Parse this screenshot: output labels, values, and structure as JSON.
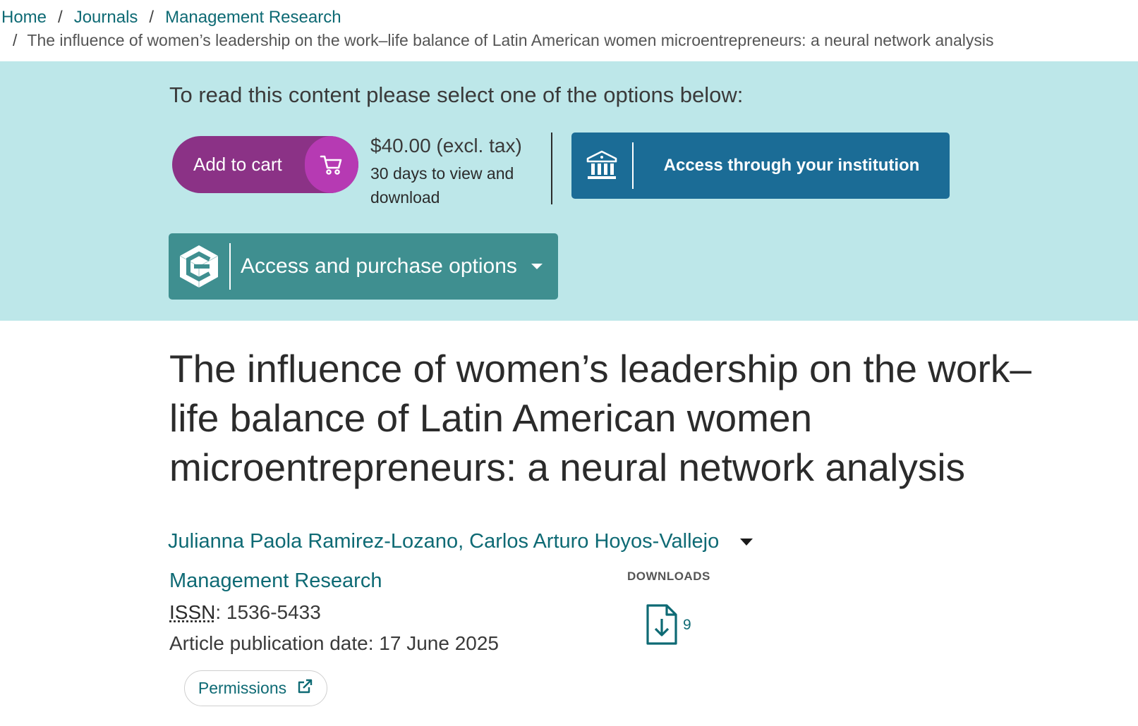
{
  "breadcrumb": {
    "home": "Home",
    "journals": "Journals",
    "journal": "Management Research",
    "current": "The influence of women’s leadership on the work–life balance of Latin American women microentrepreneurs: a neural network analysis",
    "separator": "/"
  },
  "access": {
    "prompt": "To read this content please select one of the options below:",
    "cart_label": "Add to cart",
    "price": "$40.00 (excl. tax)",
    "price_note": "30 days to view and download",
    "institution_label": "Access through your institution",
    "purchase_label": "Access and purchase options",
    "band_color": "#bde7e9",
    "cart_color": "#8b3286",
    "institution_color": "#1b6c96",
    "purchase_color": "#3f8f90"
  },
  "article": {
    "title": "The influence of women’s leadership on the work–life balance of Latin American women microentrepreneurs: a neural network analysis",
    "authors": "Julianna Paola Ramirez-Lozano, Carlos Arturo Hoyos-Vallejo",
    "journal": "Management Research",
    "issn_label": "ISSN",
    "issn_value": ": 1536-5433",
    "publication_date": "Article publication date: 17 June 2025",
    "permissions_label": "Permissions"
  },
  "metrics": {
    "downloads_label": "DOWNLOADS",
    "downloads_count": "9"
  },
  "icons": {
    "cart": "shopping-cart-icon",
    "institution": "institution-building-icon",
    "purchase_logo": "emerald-logo-icon",
    "dropdown": "caret-down-icon",
    "external_link": "external-link-icon",
    "download": "download-file-icon"
  }
}
